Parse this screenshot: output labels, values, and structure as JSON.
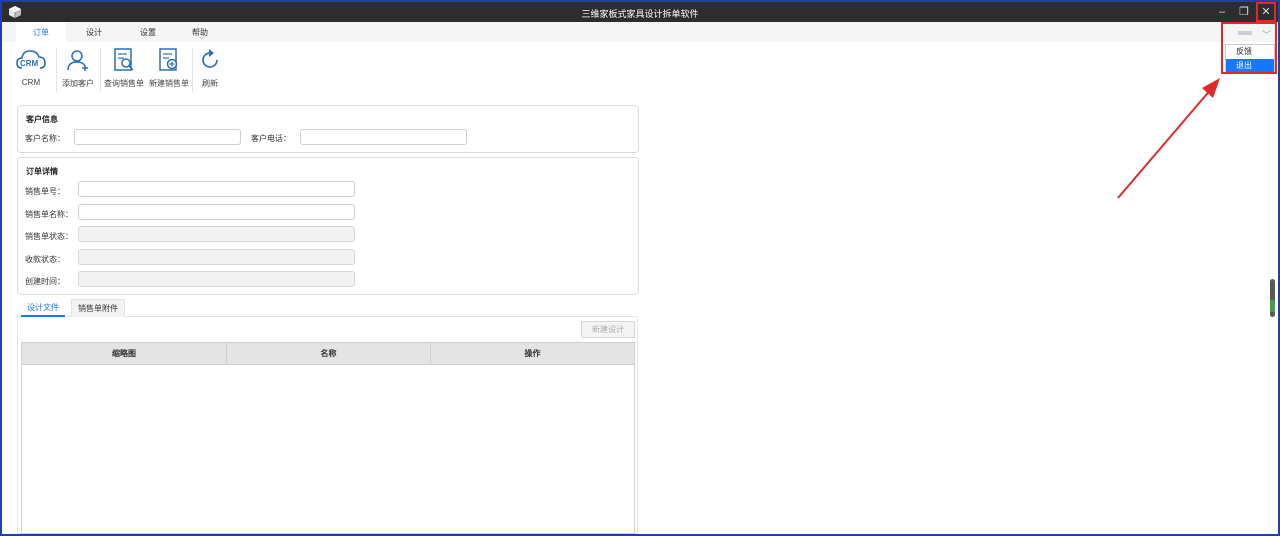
{
  "window": {
    "title": "三维家板式家具设计拆单软件",
    "minimize_glyph": "–",
    "restore_glyph": "❐",
    "close_glyph": "✕"
  },
  "menu": {
    "tabs": [
      {
        "label": "订单",
        "active": true
      },
      {
        "label": "设计",
        "active": false
      },
      {
        "label": "设置",
        "active": false
      },
      {
        "label": "帮助",
        "active": false
      }
    ]
  },
  "ribbon": {
    "buttons": [
      {
        "label": "CRM",
        "icon": "crm-cloud-icon"
      },
      {
        "label": "添加客户",
        "icon": "add-user-icon"
      },
      {
        "label": "查询销售单",
        "icon": "search-document-icon"
      },
      {
        "label": "新建销售单",
        "icon": "new-document-icon"
      },
      {
        "label": "刷新",
        "icon": "refresh-icon"
      }
    ]
  },
  "user_menu": {
    "caret": "﹀",
    "items": [
      {
        "label": "反馈",
        "selected": false
      },
      {
        "label": "退出",
        "selected": true
      }
    ]
  },
  "customer_info": {
    "title": "客户信息",
    "name_label": "客户名称：",
    "name_value": "",
    "phone_label": "客户电话：",
    "phone_value": ""
  },
  "order_detail": {
    "title": "订单详情",
    "fields": [
      {
        "label": "销售单号：",
        "value": "",
        "disabled": false
      },
      {
        "label": "销售单名称：",
        "value": "",
        "disabled": false
      },
      {
        "label": "销售单状态：",
        "value": "",
        "disabled": true
      },
      {
        "label": "收款状态：",
        "value": "",
        "disabled": true
      },
      {
        "label": "创建时间：",
        "value": "",
        "disabled": true
      }
    ]
  },
  "sub_tabs": {
    "tabs": [
      {
        "label": "设计文件",
        "active": true
      },
      {
        "label": "销售单附件",
        "active": false
      }
    ],
    "new_design_label": "新建设计",
    "table_headers": [
      "缩略图",
      "名称",
      "操作"
    ]
  },
  "colors": {
    "accent": "#1677ff",
    "titlebar": "#2d2d2d",
    "highlight": "#e02a2a"
  }
}
